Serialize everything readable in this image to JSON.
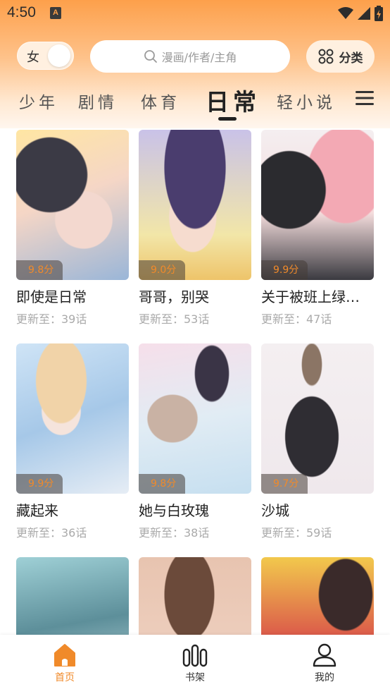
{
  "status_bar": {
    "time": "4:50",
    "notification_icon": "A"
  },
  "header": {
    "gender_label": "女",
    "search_placeholder": "漫画/作者/主角",
    "category_label": "分类"
  },
  "tabs": [
    {
      "label": "少年",
      "active": false
    },
    {
      "label": "剧情",
      "active": false
    },
    {
      "label": "体育",
      "active": false
    },
    {
      "label": "日常",
      "active": true
    },
    {
      "label": "轻小说",
      "active": false
    }
  ],
  "comics": [
    {
      "title": "即使是日常",
      "score": "9.8分",
      "update": "更新至：39话"
    },
    {
      "title": "哥哥，别哭",
      "score": "9.0分",
      "update": "更新至：53话"
    },
    {
      "title": "关于被班上绿…",
      "score": "9.9分",
      "update": "更新至：47话"
    },
    {
      "title": "藏起来",
      "score": "9.9分",
      "update": "更新至：36话"
    },
    {
      "title": "她与白玫瑰",
      "score": "9.8分",
      "update": "更新至：38话"
    },
    {
      "title": "沙城",
      "score": "9.7分",
      "update": "更新至：59话"
    },
    {
      "title": "",
      "score": "",
      "update": ""
    },
    {
      "title": "",
      "score": "",
      "update": ""
    },
    {
      "title": "",
      "score": "",
      "update": ""
    }
  ],
  "bottom_nav": [
    {
      "label": "首页",
      "icon": "home-icon",
      "active": true
    },
    {
      "label": "书架",
      "icon": "bookshelf-icon",
      "active": false
    },
    {
      "label": "我的",
      "icon": "profile-icon",
      "active": false
    }
  ],
  "colors": {
    "accent": "#f08a2a",
    "header_top": "#fda04b"
  }
}
